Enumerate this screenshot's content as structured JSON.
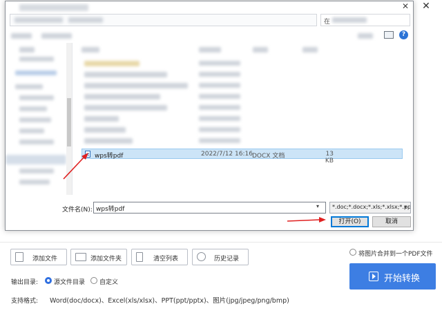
{
  "app": {
    "close_glyph": "✕",
    "min_glyph": "—",
    "buttons": {
      "add_file": "添加文件",
      "add_folder": "添加文件夹",
      "clear_list": "清空列表",
      "history": "历史记录"
    },
    "merge_option": "将图片合并到一个PDF文件",
    "start_button": "开始转换",
    "output_dir_label": "输出目录:",
    "output_options": {
      "source_dir": "源文件目录",
      "custom": "自定义"
    },
    "formats_label": "支持格式:",
    "formats_value": "Word(doc/docx)、Excel(xls/xlsx)、PPT(ppt/pptx)、图片(jpg/jpeg/png/bmp)"
  },
  "dialog": {
    "close_glyph": "✕",
    "search_prefix": "在",
    "help_glyph": "?",
    "selected_file": {
      "name": "wps转pdf",
      "date": "2022/7/12 16:16",
      "type": "DOCX 文档",
      "size": "13 KB"
    },
    "filename_label": "文件名(N):",
    "filename_value": "wps转pdf",
    "filter_value": "*.doc;*.docx;*.xls;*.xlsx;*.ppt;*",
    "open_button": "打开(O)",
    "cancel_button": "取消"
  },
  "colors": {
    "accent": "#3d7ee3",
    "selection": "#cce4f7",
    "annotation_arrow": "#e02020"
  }
}
